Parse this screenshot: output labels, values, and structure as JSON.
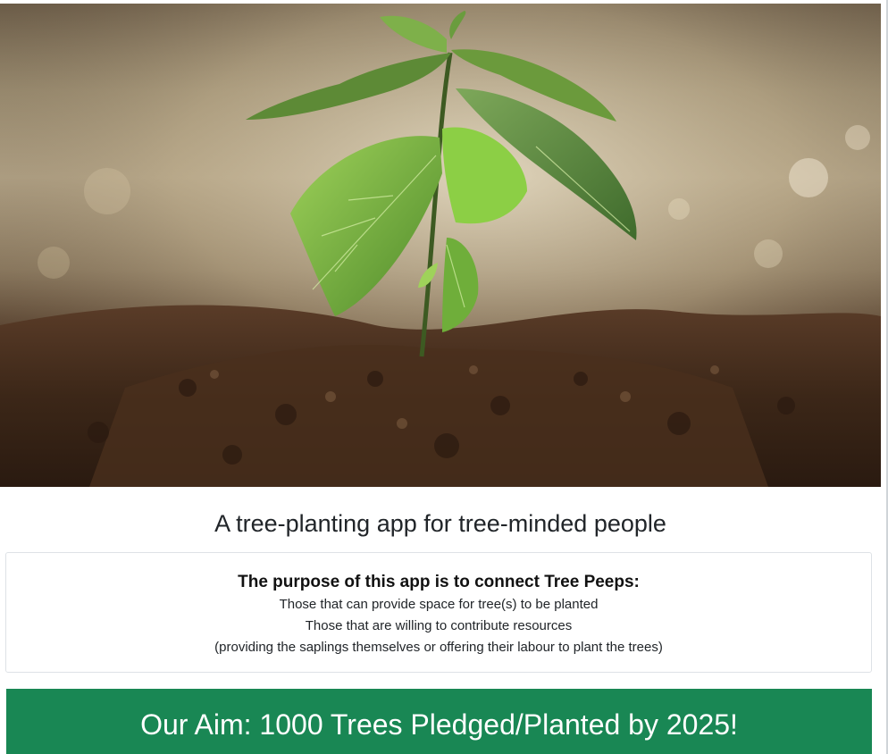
{
  "hero": {
    "image": "tree-sapling-in-soil-photo",
    "colors": {
      "leaf": "#6fae3a",
      "soil": "#3b2517"
    }
  },
  "tagline": "A tree-planting app for tree-minded people",
  "purpose": {
    "title": "The purpose of this app is to connect Tree Peeps:",
    "lines": [
      "Those that can provide space for tree(s) to be planted",
      "Those that are willing to contribute resources",
      "(providing the saplings themselves or offering their labour to plant the trees)"
    ]
  },
  "aim": {
    "text": "Our Aim: 1000 Trees Pledged/Planted by 2025!",
    "color": "#198754"
  }
}
